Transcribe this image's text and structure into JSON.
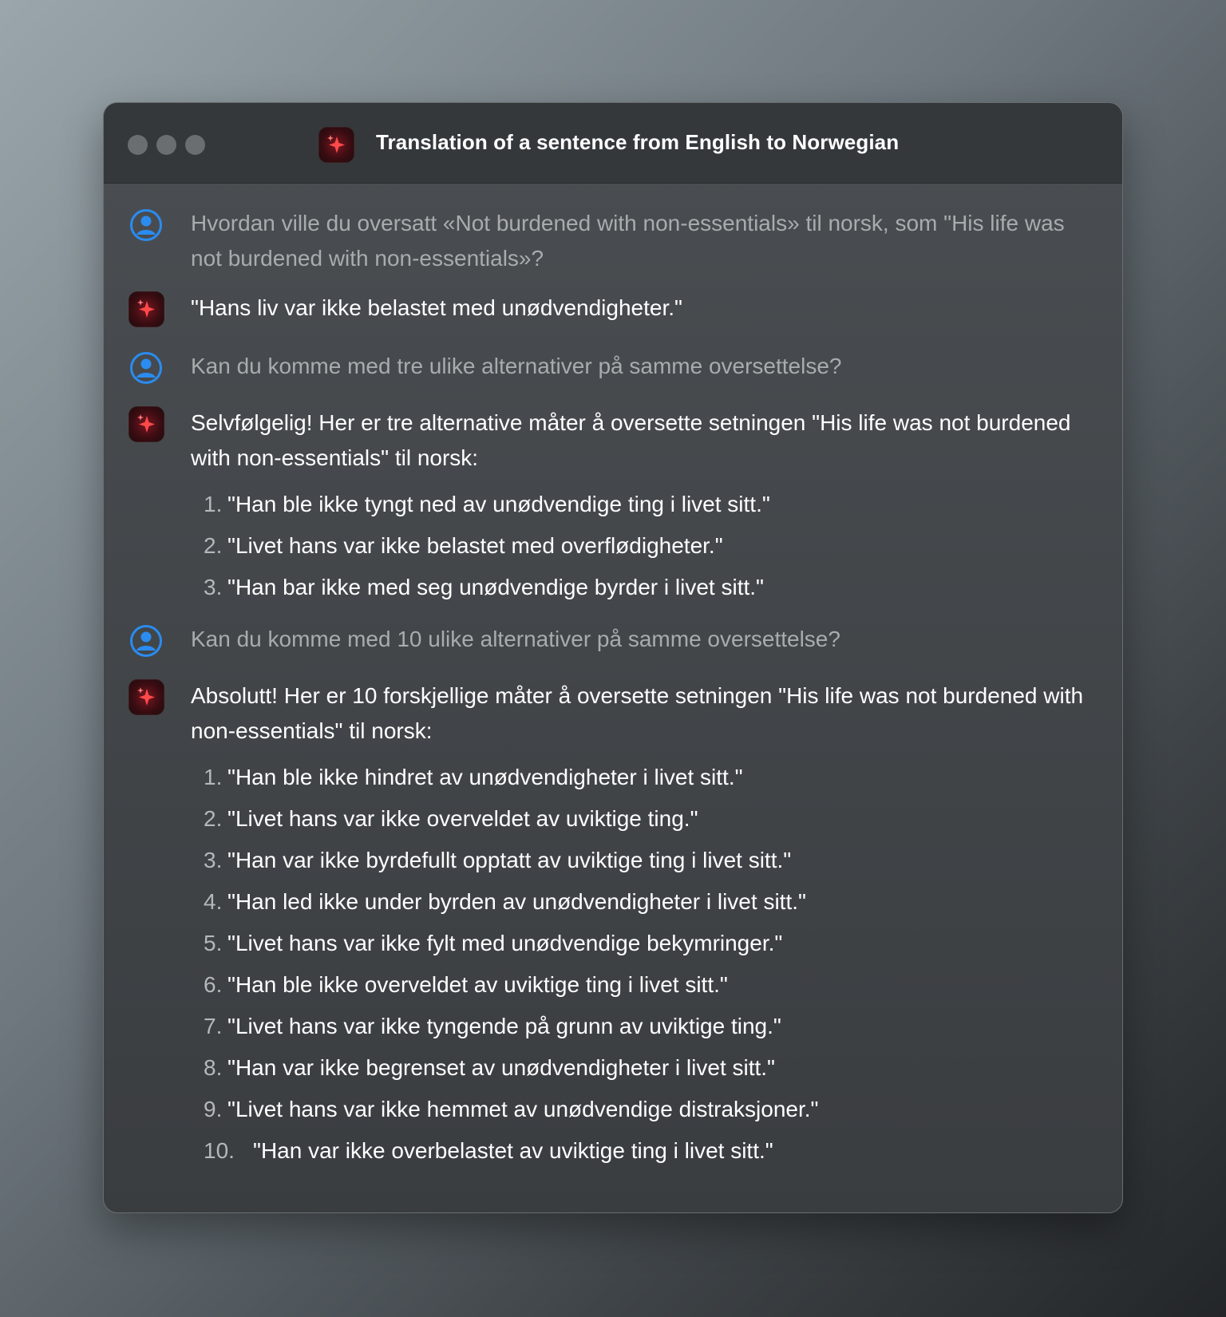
{
  "window": {
    "title": "Translation of a sentence from English to Norwegian",
    "app_icon": "sparkle-icon"
  },
  "conversation": [
    {
      "role": "user",
      "text": "Hvordan ville du oversatt «Not burdened with non-essentials» til norsk, som \"His life was not burdened with non-essentials»?"
    },
    {
      "role": "assistant",
      "text": "\"Hans liv var ikke belastet med unødvendigheter.\""
    },
    {
      "role": "user",
      "text": "Kan du komme med tre ulike alternativer på samme oversettelse?"
    },
    {
      "role": "assistant",
      "text": "Selvfølgelig! Her er tre alternative måter å oversette setningen \"His life was not burdened with non-essentials\" til norsk:",
      "list": [
        {
          "num": "1.",
          "text": "\"Han ble ikke tyngt ned av unødvendige ting i livet sitt.\""
        },
        {
          "num": "2.",
          "text": "\"Livet hans var ikke belastet med overflødigheter.\""
        },
        {
          "num": "3.",
          "text": "\"Han bar ikke med seg unødvendige byrder i livet sitt.\""
        }
      ]
    },
    {
      "role": "user",
      "text": "Kan du komme med 10 ulike alternativer på samme oversettelse?"
    },
    {
      "role": "assistant",
      "text": "Absolutt! Her er 10 forskjellige måter å oversette setningen \"His life was not burdened with non-essentials\" til norsk:",
      "list": [
        {
          "num": "1.",
          "text": "\"Han ble ikke hindret av unødvendigheter i livet sitt.\""
        },
        {
          "num": "2.",
          "text": "\"Livet hans var ikke overveldet av uviktige ting.\""
        },
        {
          "num": "3.",
          "text": "\"Han var ikke byrdefullt opptatt av uviktige ting i livet sitt.\""
        },
        {
          "num": "4.",
          "text": "\"Han led ikke under byrden av unødvendigheter i livet sitt.\""
        },
        {
          "num": "5.",
          "text": "\"Livet hans var ikke fylt med unødvendige bekymringer.\""
        },
        {
          "num": "6.",
          "text": "\"Han ble ikke overveldet av uviktige ting i livet sitt.\""
        },
        {
          "num": "7.",
          "text": "\"Livet hans var ikke tyngende på grunn av uviktige ting.\""
        },
        {
          "num": "8.",
          "text": "\"Han var ikke begrenset av unødvendigheter i livet sitt.\""
        },
        {
          "num": "9.",
          "text": "\"Livet hans var ikke hemmet av unødvendige distraksjoner.\""
        },
        {
          "num": "10.",
          "text": "\"Han var ikke overbelastet av uviktige ting i livet sitt.\""
        }
      ]
    }
  ],
  "colors": {
    "user_icon": "#2a8cf0",
    "assistant_icon_bg": "#5a0f18",
    "sparkle": "#ff4a4a"
  }
}
